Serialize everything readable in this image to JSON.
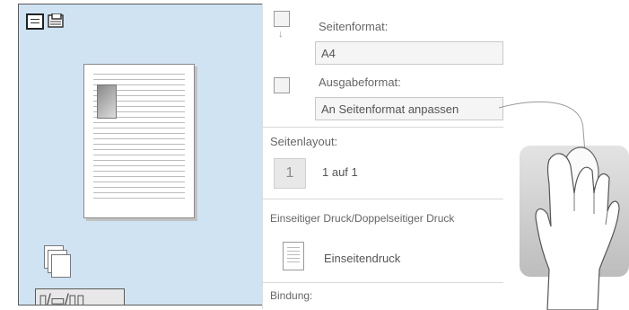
{
  "preview": {
    "view_icons": [
      "single-page-view-icon",
      "printer-view-icon"
    ],
    "bottom_icons_text": "▯/▭/▯▯"
  },
  "settings": {
    "page_format": {
      "label": "Seitenformat:",
      "value": "A4"
    },
    "output_format": {
      "label": "Ausgabeformat:",
      "value": "An Seitenformat anpassen"
    },
    "page_layout": {
      "label": "Seitenlayout:",
      "number": "1",
      "value": "1 auf 1"
    },
    "duplex": {
      "label": "Einseitiger Druck/Doppelseitiger Druck",
      "value": "Einseitendruck"
    },
    "binding": {
      "label": "Bindung:"
    }
  }
}
